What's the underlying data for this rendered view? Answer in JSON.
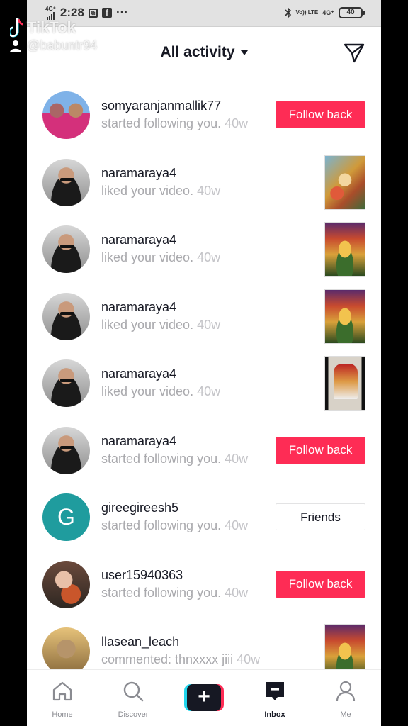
{
  "status_bar": {
    "time": "2:28",
    "network": "4G⁺",
    "screenshot_glyph": "⧉",
    "facebook_glyph": "f",
    "more": "···",
    "volte": "Vo)) LTE",
    "network_right": "4G⁺",
    "battery": "40"
  },
  "watermark": {
    "brand": "TikTok",
    "username": "@babuntr94"
  },
  "header": {
    "title": "All activity"
  },
  "activity": [
    {
      "username": "somyaranjanmallik77",
      "action": "started following you.",
      "time": "40w",
      "button": "Follow back"
    },
    {
      "username": "naramaraya4",
      "action": "liked your video.",
      "time": "40w"
    },
    {
      "username": "naramaraya4",
      "action": "liked your video.",
      "time": "40w"
    },
    {
      "username": "naramaraya4",
      "action": "liked your video.",
      "time": "40w"
    },
    {
      "username": "naramaraya4",
      "action": "liked your video.",
      "time": "40w"
    },
    {
      "username": "naramaraya4",
      "action": "started following you.",
      "time": "40w",
      "button": "Follow back"
    },
    {
      "username": "gireegireesh5",
      "avatar_letter": "G",
      "action": "started following you.",
      "time": "40w",
      "button": "Friends"
    },
    {
      "username": "user15940363",
      "action": "started following you.",
      "time": "40w",
      "button": "Follow back"
    },
    {
      "username": "llasean_leach",
      "action": "commented: thnxxxx jiii",
      "time": "40w"
    }
  ],
  "nav": {
    "home": "Home",
    "discover": "Discover",
    "create": "+",
    "inbox": "Inbox",
    "me": "Me"
  },
  "colors": {
    "accent": "#fe2c55",
    "cyan": "#20d5ec",
    "text": "#161823",
    "muted": "#a9a9ad"
  },
  "icons": {
    "send": "send-icon",
    "home": "home-icon",
    "discover": "search-icon",
    "inbox": "inbox-icon",
    "me": "profile-icon"
  }
}
